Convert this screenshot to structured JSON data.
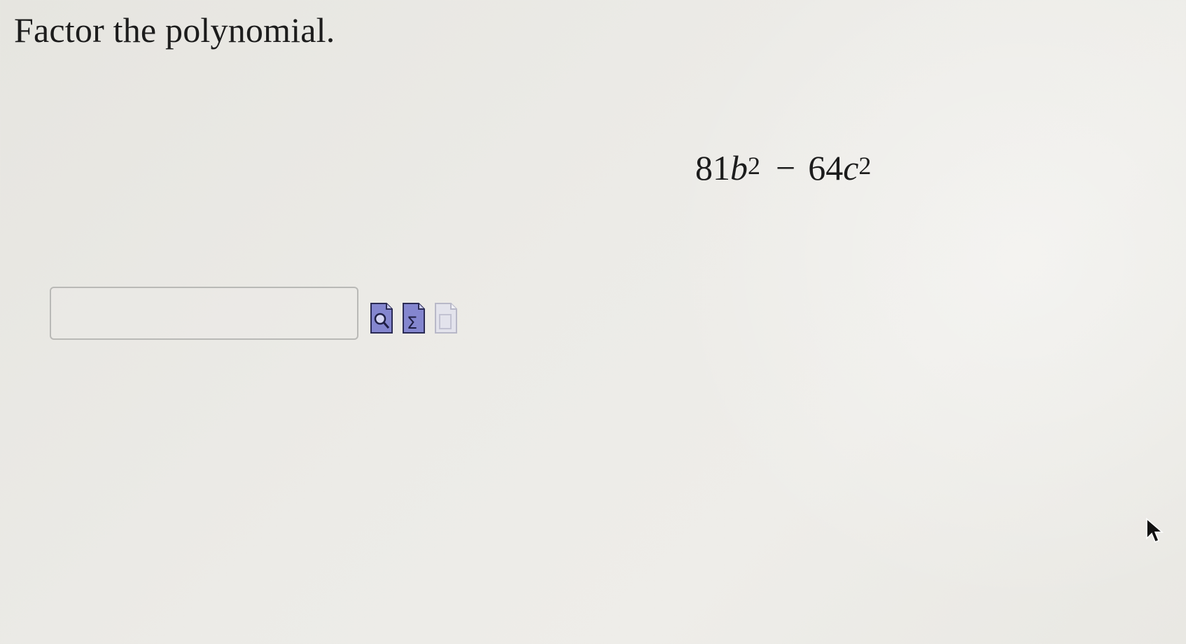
{
  "question": {
    "prompt": "Factor the polynomial.",
    "expression": {
      "term1_coef": "81",
      "term1_var": "b",
      "term1_exp": "2",
      "operator": "−",
      "term2_coef": "64",
      "term2_var": "c",
      "term2_exp": "2"
    }
  },
  "answer": {
    "value": "",
    "placeholder": ""
  },
  "tools": [
    {
      "icon": "preview-icon"
    },
    {
      "icon": "equation-editor-icon"
    },
    {
      "icon": "help-icon"
    }
  ],
  "colors": {
    "background": "#ebeae6",
    "tool_active": "#7d7fc8",
    "tool_inactive": "#c9c9dc"
  }
}
